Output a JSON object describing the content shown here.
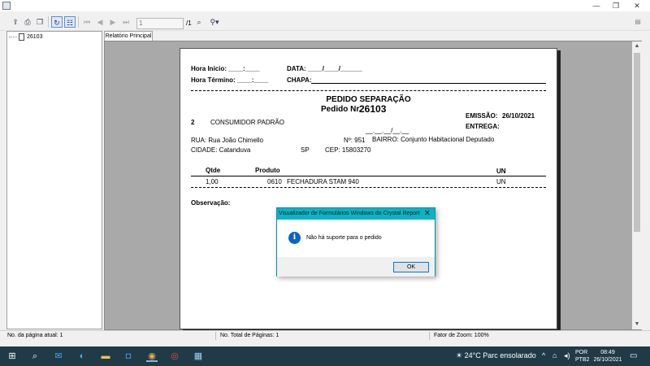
{
  "window": {
    "minimize": "—",
    "restore": "❐",
    "close": "✕"
  },
  "toolbar": {
    "page_value": "1",
    "page_total": "/1",
    "icons": [
      "export-icon",
      "print-icon",
      "copy-icon",
      "refresh-icon",
      "group-tree-icon",
      "first-page-icon",
      "prev-page-icon",
      "next-page-icon",
      "last-page-icon",
      "find-icon",
      "zoom-icon"
    ]
  },
  "tree": {
    "node": "26103"
  },
  "tab": {
    "label": "Relatório Principal"
  },
  "report": {
    "hora_inicio": "Hora Início: ____:____",
    "data": "DATA: ____/____/______",
    "hora_termino": "Hora Término: ____:____",
    "chapa": "CHAPA:",
    "title": "PEDIDO SEPARAÇÃO",
    "pedido_label": "Pedido Nr.",
    "pedido_num": "26103",
    "emissao_label": "EMISSÃO:",
    "emissao_date": "26/10/2021",
    "entrega_label": "ENTREGA:",
    "entrega_blank": "__.__.__/__.__",
    "client_code": "2",
    "client_name": "CONSUMIDOR PADRÃO",
    "rua": "RUA: Rua João Chimello",
    "numero": "Nº: 951",
    "bairro": "BAIRRO: Conjunto Habitacional Deputado",
    "cidade": "CIDADE: Catanduva",
    "uf": "SP",
    "cep": "CEP: 15803270",
    "col_qtde": "Qtde",
    "col_produto": "Produto",
    "col_un": "UN",
    "row_qtde": "1,00",
    "row_code": "0610",
    "row_desc": "FECHADURA STAM 940",
    "row_un": "UN",
    "observacao": "Observação:"
  },
  "dialog": {
    "title": "Visualizador de Formulários Windows do Crystal Report",
    "message": "Não há suporte para o pedido",
    "ok": "OK",
    "close": "✕"
  },
  "status": {
    "current_page": "No. da página atual: 1",
    "total_pages": "No. Total de Páginas: 1",
    "zoom": "Fator de Zoom: 100%"
  },
  "taskbar": {
    "temp": "24°C",
    "weather": "Parc ensolarado",
    "lang1": "POR",
    "lang2": "PTB2",
    "time": "08:49",
    "date": "26/10/2021"
  }
}
